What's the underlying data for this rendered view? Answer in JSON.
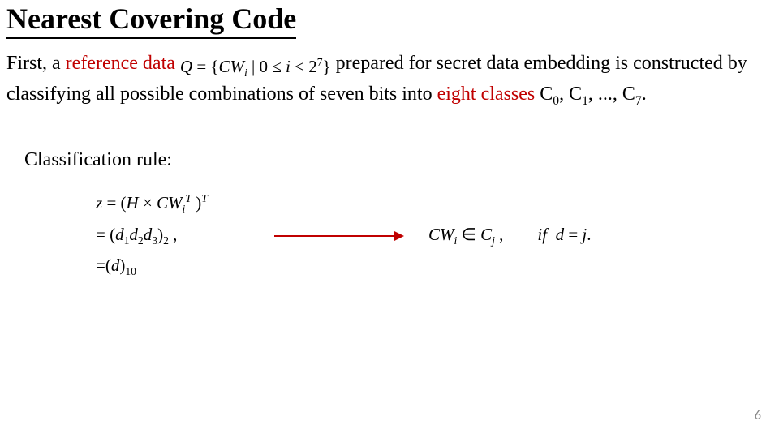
{
  "title": "Nearest Covering Code",
  "para": {
    "t1": "First, a ",
    "ref": "reference data",
    "gap": "  ",
    "formula_Q": "Q",
    "formula_eq": " = {",
    "formula_CW": "CW",
    "formula_i": "i",
    "formula_bar": " | 0 ≤ ",
    "formula_ivar": "i",
    "formula_lt": " < 2",
    "formula_exp": "7",
    "formula_close": "}",
    "t2": "   prepared for secret data embedding is constructed by classifying all possible combinations of seven bits into ",
    "eight": "eight classes",
    "t3": " C",
    "s0": "0",
    "t4": ", C",
    "s1": "1",
    "t5": ", ..., C",
    "s7": "7",
    "t6": "."
  },
  "rule_label": "Classification rule:",
  "block": {
    "r1_a": "z",
    "r1_b": " = (",
    "r1_H": "H",
    "r1_c": " × ",
    "r1_CW": "CW",
    "r1_i": "i",
    "r1_T1": "T",
    "r1_d": " )",
    "r1_T2": "T",
    "r2_a": "   = (",
    "r2_d1": "d",
    "r2_1": "1",
    "r2_d2": "d",
    "r2_2": "2",
    "r2_d3": "d",
    "r2_3": "3",
    "r2_b": ")",
    "r2_base2": "2",
    "r2_c": " ,",
    "r3_a": "   =(",
    "r3_d": "d",
    "r3_b": ")",
    "r3_base10": "10"
  },
  "result": {
    "CW": "CW",
    "i": "i",
    "in": " ∈ ",
    "C": "C",
    "j": "j",
    "comma": " ,",
    "gap": "        ",
    "if": "if",
    "sp": "  ",
    "d": "d",
    "eq": " = ",
    "jv": "j",
    "dot": "."
  },
  "pagenum": "6"
}
